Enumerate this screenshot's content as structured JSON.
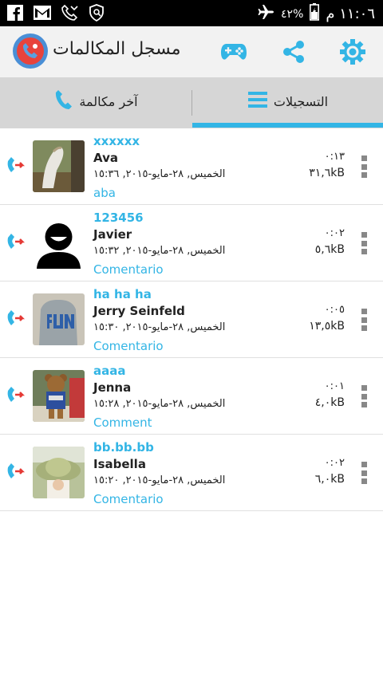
{
  "status_bar": {
    "time": "١١:٠٦ م",
    "battery": "٤٢%",
    "left_icons": [
      "facebook-icon",
      "gmail-icon",
      "missed-call-icon",
      "vpn-shield-icon"
    ],
    "right_icons": [
      "airplane-icon",
      "battery-icon"
    ]
  },
  "action_bar": {
    "title": "مسجل المكالمات",
    "buttons": [
      "gamepad-icon",
      "share-icon",
      "settings-icon"
    ],
    "accent_color": "#33b5e5"
  },
  "tabs": [
    {
      "label": "آخر مكالمة",
      "icon": "phone-icon",
      "selected": false
    },
    {
      "label": "التسجيلات",
      "icon": "list-icon",
      "selected": true
    }
  ],
  "recordings": [
    {
      "tag": "xxxxxx",
      "name": "Ava",
      "date": "الخميس, ٢٨-مايو-٢٠١٥, ١٥:٣٦",
      "comment": "aba",
      "duration": "٠:١٣",
      "size": "٣١,٦kB",
      "avatar": "horse-photo"
    },
    {
      "tag": "123456",
      "name": "Javier",
      "date": "الخميس, ٢٨-مايو-٢٠١٥, ١٥:٣٢",
      "comment": "Comentario",
      "duration": "٠:٠٢",
      "size": "٥,٦kB",
      "avatar": "default-person"
    },
    {
      "tag": "ha ha ha",
      "name": "Jerry Seinfeld",
      "date": "الخميس, ٢٨-مايو-٢٠١٥, ١٥:٣٠",
      "comment": "Comentario",
      "duration": "٠:٠٥",
      "size": "١٣,٥kB",
      "avatar": "fun-shirt-photo"
    },
    {
      "tag": "aaaa",
      "name": "Jenna",
      "date": "الخميس, ٢٨-مايو-٢٠١٥, ١٥:٢٨",
      "comment": "Comment",
      "duration": "٠:٠١",
      "size": "٤,٠kB",
      "avatar": "teddy-bear-photo"
    },
    {
      "tag": "bb.bb.bb",
      "name": "Isabella",
      "date": "الخميس, ٢٨-مايو-٢٠١٥, ١٥:٢٠",
      "comment": "Comentario",
      "duration": "٠:٠٢",
      "size": "٦,٠kB",
      "avatar": "sun-hat-photo"
    }
  ]
}
